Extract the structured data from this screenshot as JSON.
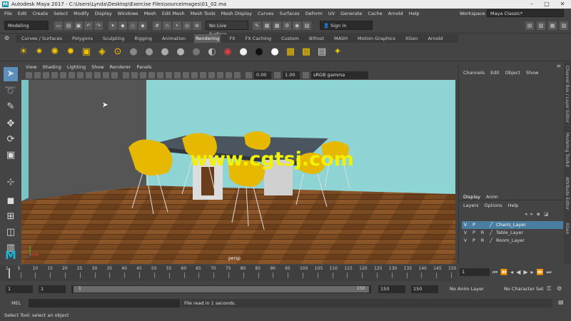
{
  "window": {
    "title": "Autodesk Maya 2017 - C:\\Users\\Lynda\\Desktop\\Exercise Files\\sourceimages\\01_02.ma",
    "minimize": "–",
    "maximize": "□",
    "close": "✕"
  },
  "menu": {
    "items": [
      "File",
      "Edit",
      "Create",
      "Select",
      "Modify",
      "Display",
      "Windows",
      "Mesh",
      "Edit Mesh",
      "Mesh Tools",
      "Mesh Display",
      "Curves",
      "Surfaces",
      "Deform",
      "UV",
      "Generate",
      "Cache",
      "Arnold",
      "Help"
    ],
    "workspace_label": "Workspace :",
    "workspace_value": "Maya Classic*"
  },
  "status": {
    "mode": "Modeling",
    "live_surface": "No Live Surface",
    "sign_in": "Sign In"
  },
  "shelf": {
    "tabs": [
      "Curves / Surfaces",
      "Polygons",
      "Sculpting",
      "Rigging",
      "Animation",
      "Rendering",
      "FX",
      "FX Caching",
      "Custom",
      "Bifrost",
      "MASH",
      "Motion Graphics",
      "XGen",
      "Arnold"
    ],
    "active_tab": "Rendering"
  },
  "viewport": {
    "menu": [
      "View",
      "Shading",
      "Lighting",
      "Show",
      "Renderer",
      "Panels"
    ],
    "exposure": "0.00",
    "gamma": "1.00",
    "color_space": "sRGB gamma",
    "camera_label": "persp",
    "watermark": "www.cgtsj.com",
    "colors": {
      "wall": "#8fd4d4",
      "floor": "#7a4a22",
      "chair": "#e6b800",
      "table_top": "#4a5560",
      "table_base": "#dcdcdc"
    }
  },
  "channelbox": {
    "menu": [
      "Channels",
      "Edit",
      "Object",
      "Show"
    ]
  },
  "side_tabs": [
    "Channel Box / Layer Editor",
    "Modeling Toolkit",
    "Attribute Editor",
    "XGen"
  ],
  "layers": {
    "tabs": [
      "Display",
      "Anim"
    ],
    "menu": [
      "Layers",
      "Options",
      "Help"
    ],
    "rows": [
      {
        "v": "V",
        "p": "P",
        "r": "",
        "name": "Chairs_Layer",
        "selected": true
      },
      {
        "v": "V",
        "p": "P",
        "r": "R",
        "name": "Table_Layer",
        "selected": false
      },
      {
        "v": "V",
        "p": "P",
        "r": "R",
        "name": "Room_Layer",
        "selected": false
      }
    ]
  },
  "timeline": {
    "ticks": [
      "1",
      "5",
      "10",
      "15",
      "20",
      "25",
      "30",
      "35",
      "40",
      "45",
      "50",
      "55",
      "60",
      "65",
      "70",
      "75",
      "80",
      "85",
      "90",
      "95",
      "100",
      "105",
      "110",
      "115",
      "120",
      "125",
      "130",
      "135",
      "140",
      "145",
      "150"
    ],
    "current_frame": "1"
  },
  "range": {
    "start": "1",
    "playback_start": "1",
    "slider_start": "1",
    "slider_end": "150",
    "playback_end": "150",
    "end": "150",
    "anim_layer": "No Anim Layer",
    "character_set": "No Character Set"
  },
  "command": {
    "language": "MEL",
    "result": "File read in  1 seconds."
  },
  "help_line": "Select Tool: select an object"
}
